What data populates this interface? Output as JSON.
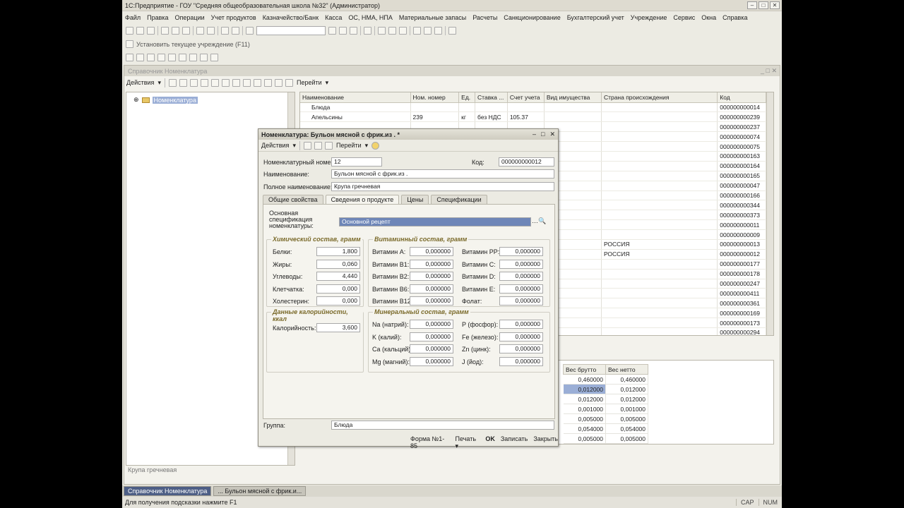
{
  "app": {
    "title": "1С:Предприятие - ГОУ \"Средняя общеобразовательная школа №32\" (Администратор)",
    "menu": [
      "Файл",
      "Правка",
      "Операции",
      "Учет продуктов",
      "Казначейство/Банк",
      "Касса",
      "ОС, НМА, НПА",
      "Материальные запасы",
      "Расчеты",
      "Санкционирование",
      "Бухгалтерский учет",
      "Учреждение",
      "Сервис",
      "Окна",
      "Справка"
    ],
    "set_institution": "Установить текущее учреждение (F11)"
  },
  "list_window": {
    "title": "Справочник Номенклатура",
    "actions_label": "Действия",
    "go_label": "Перейти",
    "tree_root": "Номенклатура",
    "columns": [
      "Наименование",
      "Ном. номер",
      "Ед.",
      "Ставка ...",
      "Счет учета",
      "Вид имущества",
      "Страна происхождения",
      "Код"
    ],
    "rows": [
      {
        "name": "Блюда",
        "num": "",
        "unit": "",
        "rate": "",
        "acct": "",
        "kind": "",
        "country": "",
        "code": "000000000014"
      },
      {
        "name": "Апельсины",
        "num": "239",
        "unit": "кг",
        "rate": "без НДС",
        "acct": "105.37",
        "kind": "",
        "country": "",
        "code": "000000000239"
      },
      {
        "name": "",
        "num": "",
        "unit": "",
        "rate": "",
        "acct": "",
        "kind": "",
        "country": "",
        "code": "000000000237"
      },
      {
        "name": "",
        "num": "",
        "unit": "",
        "rate": "",
        "acct": "",
        "kind": "",
        "country": "",
        "code": "000000000074"
      },
      {
        "name": "",
        "num": "",
        "unit": "",
        "rate": "",
        "acct": "",
        "kind": "",
        "country": "",
        "code": "000000000075"
      },
      {
        "name": "",
        "num": "",
        "unit": "",
        "rate": "",
        "acct": "",
        "kind": "",
        "country": "",
        "code": "000000000163"
      },
      {
        "name": "",
        "num": "",
        "unit": "",
        "rate": "",
        "acct": "",
        "kind": "",
        "country": "",
        "code": "000000000164"
      },
      {
        "name": "",
        "num": "",
        "unit": "",
        "rate": "",
        "acct": "",
        "kind": "",
        "country": "",
        "code": "000000000165"
      },
      {
        "name": "",
        "num": "",
        "unit": "",
        "rate": "",
        "acct": "",
        "kind": "",
        "country": "",
        "code": "000000000047"
      },
      {
        "name": "",
        "num": "",
        "unit": "",
        "rate": "",
        "acct": "",
        "kind": "",
        "country": "",
        "code": "000000000166"
      },
      {
        "name": "",
        "num": "",
        "unit": "",
        "rate": "",
        "acct": "",
        "kind": "",
        "country": "",
        "code": "000000000344"
      },
      {
        "name": "",
        "num": "",
        "unit": "",
        "rate": "",
        "acct": "",
        "kind": "",
        "country": "",
        "code": "000000000373"
      },
      {
        "name": "",
        "num": "",
        "unit": "",
        "rate": "",
        "acct": "",
        "kind": "",
        "country": "",
        "code": "000000000011"
      },
      {
        "name": "",
        "num": "",
        "unit": "",
        "rate": "",
        "acct": "",
        "kind": "",
        "country": "",
        "code": "000000000009"
      },
      {
        "name": "",
        "num": "",
        "unit": "",
        "rate": "",
        "acct": "",
        "kind": "",
        "country": "РОССИЯ",
        "code": "000000000013"
      },
      {
        "name": "",
        "num": "",
        "unit": "",
        "rate": "",
        "acct": "",
        "kind": "",
        "country": "РОССИЯ",
        "code": "000000000012"
      },
      {
        "name": "",
        "num": "",
        "unit": "",
        "rate": "",
        "acct": "",
        "kind": "",
        "country": "",
        "code": "000000000177"
      },
      {
        "name": "",
        "num": "",
        "unit": "",
        "rate": "",
        "acct": "",
        "kind": "",
        "country": "",
        "code": "000000000178"
      },
      {
        "name": "",
        "num": "",
        "unit": "",
        "rate": "",
        "acct": "",
        "kind": "",
        "country": "",
        "code": "000000000247"
      },
      {
        "name": "",
        "num": "",
        "unit": "",
        "rate": "",
        "acct": "",
        "kind": "",
        "country": "",
        "code": "000000000411"
      },
      {
        "name": "",
        "num": "",
        "unit": "",
        "rate": "",
        "acct": "",
        "kind": "",
        "country": "",
        "code": "000000000361"
      },
      {
        "name": "",
        "num": "",
        "unit": "",
        "rate": "",
        "acct": "",
        "kind": "",
        "country": "",
        "code": "000000000169"
      },
      {
        "name": "",
        "num": "",
        "unit": "",
        "rate": "",
        "acct": "",
        "kind": "",
        "country": "",
        "code": "000000000173"
      },
      {
        "name": "",
        "num": "",
        "unit": "",
        "rate": "",
        "acct": "",
        "kind": "",
        "country": "",
        "code": "000000000294"
      }
    ],
    "spec_columns": [
      "Вес брутто",
      "Вес нетто"
    ],
    "spec_rows": [
      [
        "0,460000",
        "0,460000"
      ],
      [
        "0,012000",
        "0,012000"
      ],
      [
        "0,012000",
        "0,012000"
      ],
      [
        "0,001000",
        "0,001000"
      ],
      [
        "0,005000",
        "0,005000"
      ],
      [
        "0,054000",
        "0,054000"
      ],
      [
        "0,005000",
        "0,005000"
      ]
    ],
    "footer_text": "Крупа гречневая"
  },
  "dialog": {
    "title": "Номенклатура: Бульон мясной с фрик.из . *",
    "actions_label": "Действия",
    "go_label": "Перейти",
    "nom_number_label": "Номенклатурный номер:",
    "nom_number": "12",
    "code_label": "Код:",
    "code": "000000000012",
    "name_label": "Наименование:",
    "name": "Бульон мясной с фрик.из .",
    "full_name_label": "Полное наименование:",
    "full_name": "Крупа гречневая",
    "tabs": [
      "Общие свойства",
      "Сведения о продукте",
      "Цены",
      "Спецификации"
    ],
    "spec_label": "Основная спецификация номенклатуры:",
    "spec_value": "Основной рецепт",
    "chem_title": "Химический состав, грамм",
    "chem": [
      [
        "Белки:",
        "1,800"
      ],
      [
        "Жиры:",
        "0,060"
      ],
      [
        "Углеводы:",
        "4,440"
      ],
      [
        "Клетчатка:",
        "0,000"
      ],
      [
        "Холестерин:",
        "0,000"
      ]
    ],
    "vit_title": "Витаминный состав, грамм",
    "vit_left": [
      [
        "Витамин А:",
        "0,000000"
      ],
      [
        "Витамин В1:",
        "0,000000"
      ],
      [
        "Витамин В2:",
        "0,000000"
      ],
      [
        "Витамин В6:",
        "0,000000"
      ],
      [
        "Витамин В12:",
        "0,000000"
      ]
    ],
    "vit_right": [
      [
        "Витамин PP:",
        "0,000000"
      ],
      [
        "Витамин C:",
        "0,000000"
      ],
      [
        "Витамин D:",
        "0,000000"
      ],
      [
        "Витамин E:",
        "0,000000"
      ],
      [
        "Фолат:",
        "0,000000"
      ]
    ],
    "cal_title": "Данные калорийности, ккал",
    "cal_label": "Калорийность:",
    "cal_value": "3,600",
    "min_title": "Минеральный состав, грамм",
    "min_left": [
      [
        "Na (натрий):",
        "0,000000"
      ],
      [
        "K (калий):",
        "0,000000"
      ],
      [
        "Ca (кальций):",
        "0,000000"
      ],
      [
        "Mg (магний):",
        "0,000000"
      ]
    ],
    "min_right": [
      [
        "P (фосфор):",
        "0,000000"
      ],
      [
        "Fe (железо):",
        "0,000000"
      ],
      [
        "Zn (цинк):",
        "0,000000"
      ],
      [
        "J (йод):",
        "0,000000"
      ]
    ],
    "group_label": "Группа:",
    "group_value": "Блюда",
    "btn_form": "Форма №1-85",
    "btn_print": "Печать",
    "btn_ok": "OK",
    "btn_save": "Записать",
    "btn_close": "Закрыть"
  },
  "taskbar": [
    "Справочник Номенклатура",
    "... Бульон мясной с фрик.и..."
  ],
  "status": {
    "message": "Для получения подсказки нажмите F1",
    "cap": "CAP",
    "num": "NUM"
  }
}
